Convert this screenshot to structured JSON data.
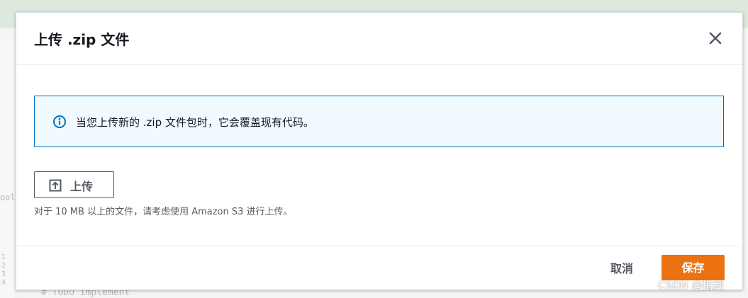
{
  "background": {
    "fragment_text": "ools",
    "code_comment": "# TODO implement",
    "line_numbers": [
      "1",
      "2",
      "3",
      "4"
    ]
  },
  "modal": {
    "title": "上传 .zip 文件",
    "info_icon": "info-circle-icon",
    "info_text": "当您上传新的 .zip 文件包时，它会覆盖现有代码。",
    "upload_icon": "upload-arrow-icon",
    "upload_label": "上传",
    "hint": "对于 10 MB 以上的文件，请考虑使用 Amazon S3 进行上传。",
    "close_icon": "close-icon",
    "cancel_label": "取消",
    "save_label": "保存"
  },
  "watermark": "CSDN @指剑",
  "colors": {
    "accent_orange": "#ec7211",
    "info_border": "#0073bb",
    "info_bg": "#f1faff",
    "text_dark": "#16191f",
    "text_gray": "#545b64"
  }
}
